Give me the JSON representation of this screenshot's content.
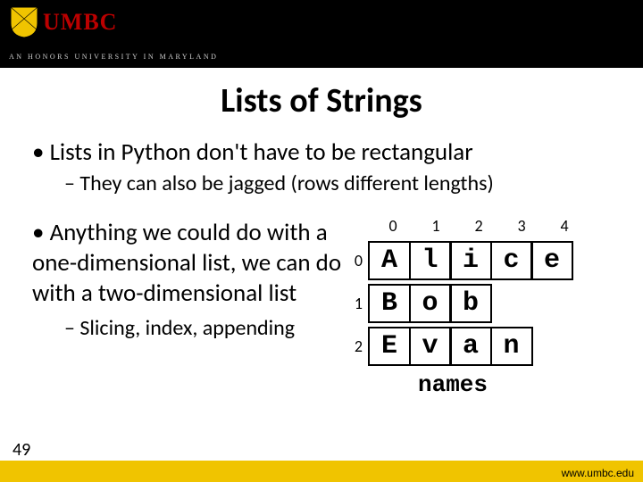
{
  "header": {
    "logo_text": "UMBC",
    "tagline": "AN HONORS UNIVERSITY IN MARYLAND"
  },
  "title": "Lists of Strings",
  "bullets": {
    "main1": "Lists in Python don't have to be rectangular",
    "sub1": "They can also be jagged (rows different lengths)",
    "main2": "Anything we could do with a one-dimensional list, we can do with a two-dimensional list",
    "sub2": "Slicing, index, appending"
  },
  "grid": {
    "col_labels": [
      "0",
      "1",
      "2",
      "3",
      "4"
    ],
    "rows": [
      {
        "label": "0",
        "cells": [
          "A",
          "l",
          "i",
          "c",
          "e"
        ]
      },
      {
        "label": "1",
        "cells": [
          "B",
          "o",
          "b"
        ]
      },
      {
        "label": "2",
        "cells": [
          "E",
          "v",
          "a",
          "n"
        ]
      }
    ],
    "var_name": "names"
  },
  "footer": {
    "page": "49",
    "url": "www.umbc.edu"
  },
  "chart_data": {
    "type": "table",
    "title": "names (jagged 2D list of characters)",
    "col_headers": [
      "0",
      "1",
      "2",
      "3",
      "4"
    ],
    "row_headers": [
      "0",
      "1",
      "2"
    ],
    "rows": [
      [
        "A",
        "l",
        "i",
        "c",
        "e"
      ],
      [
        "B",
        "o",
        "b"
      ],
      [
        "E",
        "v",
        "a",
        "n"
      ]
    ]
  }
}
